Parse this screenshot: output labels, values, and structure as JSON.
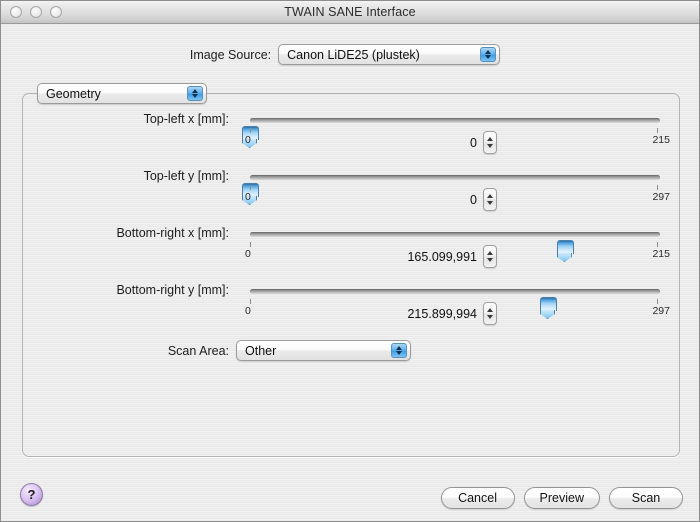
{
  "window": {
    "title": "TWAIN SANE Interface",
    "traffic_lights": [
      "close-button",
      "minimize-button",
      "zoom-button"
    ]
  },
  "image_source": {
    "label": "Image Source:",
    "value": "Canon LiDE25 (plustek)"
  },
  "group": {
    "selected": "Geometry"
  },
  "sliders": [
    {
      "label": "Top-left x [mm]:",
      "value_text": "0",
      "value": 0,
      "min": 0,
      "max": 215,
      "min_label": "0",
      "max_label": "215",
      "thumb_percent": 0
    },
    {
      "label": "Top-left y [mm]:",
      "value_text": "0",
      "value": 0,
      "min": 0,
      "max": 297,
      "min_label": "0",
      "max_label": "297",
      "thumb_percent": 0
    },
    {
      "label": "Bottom-right x [mm]:",
      "value_text": "165.099,991",
      "value": 165.099991,
      "min": 0,
      "max": 215,
      "min_label": "0",
      "max_label": "215",
      "thumb_percent": 76.8
    },
    {
      "label": "Bottom-right y [mm]:",
      "value_text": "215.899,994",
      "value": 215.899994,
      "min": 0,
      "max": 297,
      "min_label": "0",
      "max_label": "297",
      "thumb_percent": 72.7
    }
  ],
  "scan_area": {
    "label": "Scan Area:",
    "value": "Other"
  },
  "footer": {
    "help_label": "?",
    "cancel_label": "Cancel",
    "preview_label": "Preview",
    "scan_label": "Scan"
  },
  "colors": {
    "accent_blue": "#63b3ef",
    "thumb_blue": "#4e9fdc",
    "help_purple": "#bb9ee0",
    "window_bg": "#ececec"
  }
}
